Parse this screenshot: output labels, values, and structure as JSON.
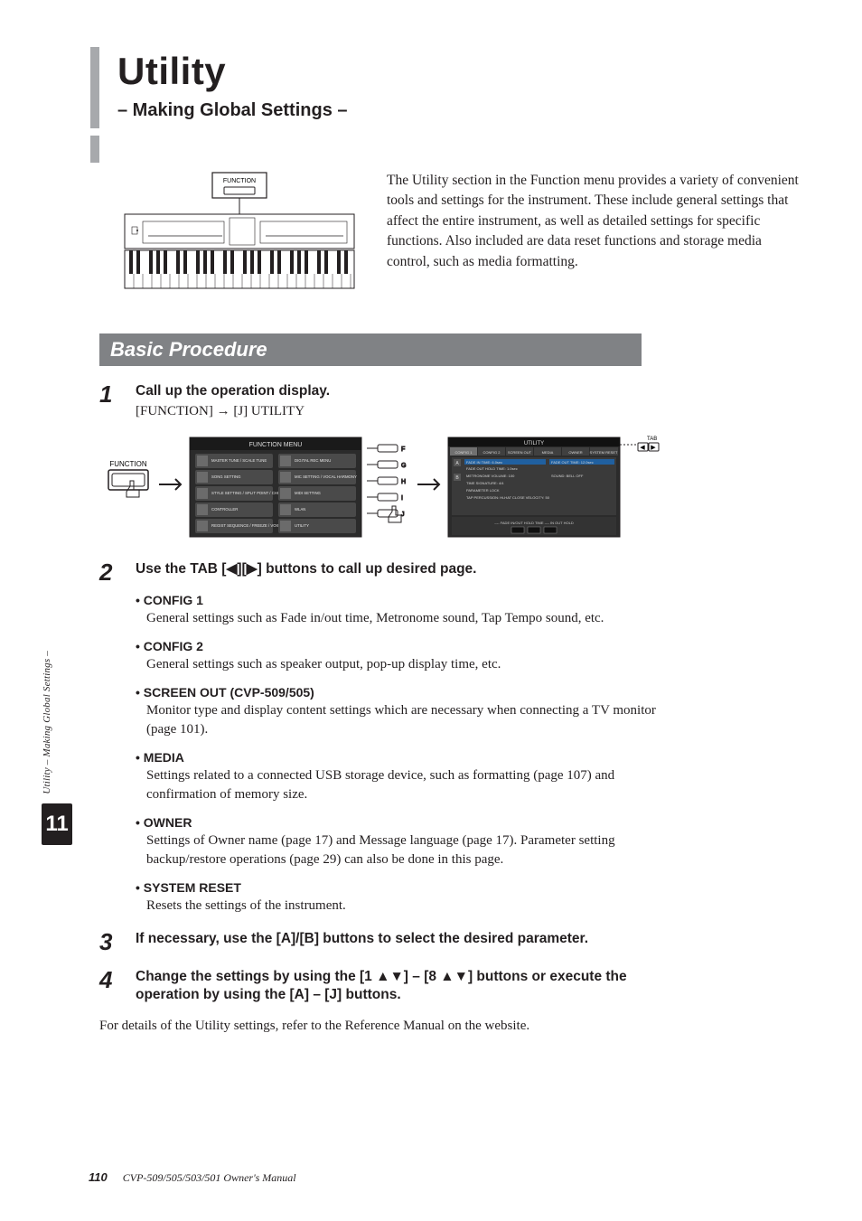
{
  "side": {
    "vertical_label": "Utility – Making Global Settings –",
    "chapter_number": "11"
  },
  "header": {
    "title": "Utility",
    "subtitle": "– Making Global Settings –"
  },
  "device": {
    "function_label": "FUNCTION"
  },
  "intro": "The Utility section in the Function menu provides a variety of convenient tools and settings for the instrument. These include general settings that affect the entire instrument, as well as detailed settings for specific functions. Also included are data reset functions and storage media control, such as media formatting.",
  "section_title": "Basic Procedure",
  "steps": {
    "s1": {
      "num": "1",
      "title": "Call up the operation display.",
      "sub": "[FUNCTION] → [J] UTILITY",
      "fig": {
        "function_label": "FUNCTION",
        "menu_title": "FUNCTION MENU",
        "menu_items_left": [
          "MASTER TUNE / SCALE TUNE",
          "SONG SETTING",
          "STYLE SETTING / SPLIT POINT / CHORD FINGERING",
          "CONTROLLER",
          "REGIST SEQUENCE / FREEZE / VOICE SET"
        ],
        "menu_items_right": [
          "DIGITAL REC MENU",
          "MIC SETTING / VOCAL HARMONY",
          "MIDI SETTING",
          "WLAN",
          "UTILITY"
        ],
        "util_title": "UTILITY",
        "util_tabs": [
          "CONFIG 1",
          "CONFIG 2",
          "SCREEN OUT",
          "MEDIA",
          "OWNER",
          "SYSTEM RESET"
        ],
        "util_fields": [
          "FADE IN TIME: 6.0sec",
          "FADE OUT TIME: 12.0sec",
          "FADE OUT HOLD TIME: 1.0sec",
          "METRONOME VOLUME: 100",
          "SOUND: BELL OFF",
          "TIME SIGNATURE: 4/4",
          "PARAMETER LOCK",
          "TAP    PERCUSSION: Hi-HAT CLOSE    VELOCITY: 50"
        ],
        "util_footer": "---- FADE IN/OUT HOLD TIME ----   IN   OUT   HOLD",
        "tab_icons": "TAB ◀ ▶"
      }
    },
    "s2": {
      "num": "2",
      "title": "Use the TAB [◀][▶] buttons to call up desired page.",
      "bullets": [
        {
          "label": "• CONFIG 1",
          "desc": "General settings such as Fade in/out time, Metronome sound, Tap Tempo sound, etc."
        },
        {
          "label": "• CONFIG 2",
          "desc": "General settings such as speaker output, pop-up display time, etc."
        },
        {
          "label": "• SCREEN OUT (CVP-509/505)",
          "desc": "Monitor type and display content settings which are necessary when connecting a TV monitor (page 101)."
        },
        {
          "label": "• MEDIA",
          "desc": "Settings related to a connected USB storage device, such as formatting (page 107) and confirmation of memory size."
        },
        {
          "label": "• OWNER",
          "desc": "Settings of Owner name (page 17) and Message language (page 17). Parameter setting backup/restore operations (page 29) can also be done in this page."
        },
        {
          "label": "• SYSTEM RESET",
          "desc": "Resets the settings of the instrument."
        }
      ]
    },
    "s3": {
      "num": "3",
      "title": "If necessary, use the [A]/[B] buttons to select the desired parameter."
    },
    "s4": {
      "num": "4",
      "title": "Change the settings by using the [1 ▲▼] – [8 ▲▼] buttons or execute the operation by using the [A] – [J] buttons."
    }
  },
  "details_line": "For details of the Utility settings, refer to the Reference Manual on the website.",
  "footer": {
    "page": "110",
    "manual": "CVP-509/505/503/501 Owner's Manual"
  }
}
